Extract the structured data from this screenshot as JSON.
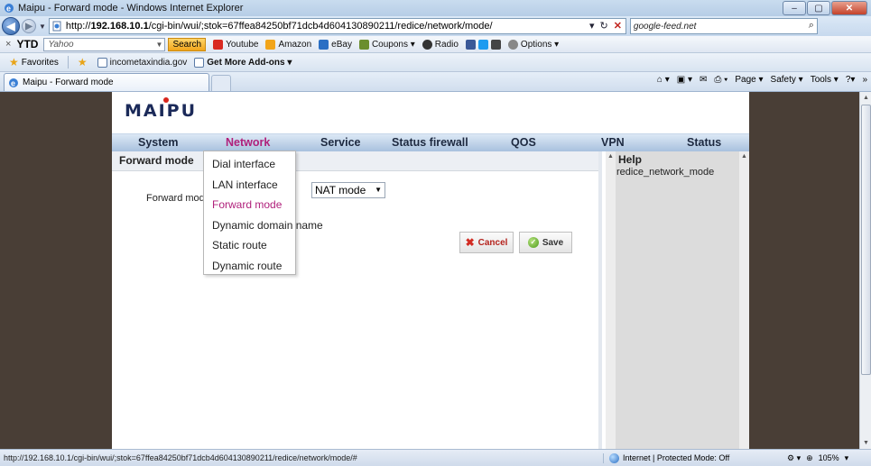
{
  "window": {
    "title": "Maipu - Forward mode - Windows Internet Explorer",
    "buttons": {
      "minimize": "–",
      "maximize": "▢",
      "close": "✕"
    }
  },
  "address": {
    "url_prefix": "http://",
    "url_host": "192.168.10.1",
    "url_path": "/cgi-bin/wui/;stok=67ffea84250bf71dcb4d604130890211/redice/network/mode/",
    "search_placeholder": "google-feed.net"
  },
  "toolbar": {
    "close": "×",
    "ytd": "YTD",
    "yahoo_text": "Yahoo",
    "search_label": "Search",
    "items": [
      "Youtube",
      "Amazon",
      "eBay",
      "Coupons ▾",
      "Radio",
      "Options ▾"
    ]
  },
  "favorites": {
    "label": "Favorites",
    "links": [
      "incometaxindia.gov",
      "Get More Add-ons ▾"
    ]
  },
  "tab": {
    "title": "Maipu - Forward mode"
  },
  "commandbar": {
    "page": "Page ▾",
    "safety": "Safety ▾",
    "tools": "Tools ▾"
  },
  "app": {
    "logo": "MAIPU",
    "nav": [
      "System",
      "Network",
      "Service",
      "Status firewall",
      "QOS",
      "VPN",
      "Status"
    ],
    "active_nav": "Network",
    "panel_title": "Forward mode",
    "form": {
      "forward_mode_label": "Forward mode",
      "forward_mode_value": "NAT mode",
      "cancel_label": "Cancel",
      "save_label": "Save"
    },
    "help": {
      "title": "Help",
      "text": "redice_network_mode"
    },
    "dropdown": [
      "Dial interface",
      "LAN interface",
      "Forward mode",
      "Dynamic domain name",
      "Static route",
      "Dynamic route"
    ],
    "active_dropdown": "Forward mode"
  },
  "statusbar": {
    "url": "http://192.168.10.1/cgi-bin/wui/;stok=67ffea84250bf71dcb4d604130890211/redice/network/mode/#",
    "zone": "Internet | Protected Mode: Off",
    "zoom": "105%"
  },
  "colors": {
    "accent_active": "#b0207b",
    "cancel_red": "#b4221c",
    "dark_bg": "#493e36"
  }
}
